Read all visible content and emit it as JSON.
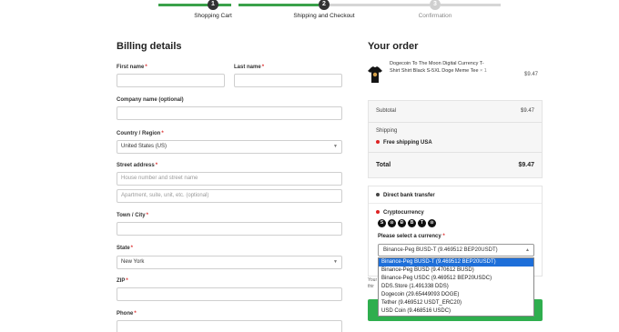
{
  "stepper": {
    "steps": [
      {
        "number": "1",
        "label": "Shopping Cart"
      },
      {
        "number": "2",
        "label": "Shipping and Checkout"
      },
      {
        "number": "3",
        "label": "Confirmation"
      }
    ]
  },
  "billing": {
    "title": "Billing details",
    "first_name_label": "First name",
    "last_name_label": "Last name",
    "company_label": "Company name (optional)",
    "country_label": "Country / Region",
    "country_value": "United States (US)",
    "street_label": "Street address",
    "street_placeholder": "House number and street name",
    "apartment_placeholder": "Apartment, suite, unit, etc. (optional)",
    "city_label": "Town / City",
    "state_label": "State",
    "state_value": "New York",
    "zip_label": "ZIP",
    "phone_label": "Phone",
    "required_mark": "*"
  },
  "order": {
    "title": "Your order",
    "product_name": "Dogecoin To The Moon Digital Currency T-Shirt Shirt Black S-5XL Doge Meme Tee",
    "product_qty": "× 1",
    "product_price": "$9.47",
    "subtotal_label": "Subtotal",
    "subtotal_value": "$9.47",
    "shipping_label": "Shipping",
    "shipping_option": "Free shipping USA",
    "total_label": "Total",
    "total_value": "$9.47"
  },
  "payment": {
    "bank_label": "Direct bank transfer",
    "crypto_label": "Cryptocurrency",
    "coin_icons": [
      "S",
      "⊙",
      "Ð",
      "B",
      "T",
      "⊙"
    ],
    "currency_label": "Please select a currency",
    "required_mark": "*",
    "currency_selected": "Binance-Peg BUSD-T (9.469512 BEP20USDT)",
    "currency_options": [
      "Binance-Peg BUSD-T (9.469512 BEP20USDT)",
      "Binance-Peg BUSD (9.470612 BUSD)",
      "Binance-Peg USDC (9.469512 BEP20USDC)",
      "DDS.Store (1.491338 DDS)",
      "Dogecoin (29.65449093 DOGE)",
      "Tether (9.469512 USDT_ERC20)",
      "USD Coin (9.468516 USDC)"
    ],
    "behind_text": "Your thir"
  },
  "colors": {
    "progress_done": "#3aa14a",
    "accent_red": "#d22222",
    "dropdown_highlight": "#1e6fd9",
    "place_order_green": "#2fae4e"
  }
}
